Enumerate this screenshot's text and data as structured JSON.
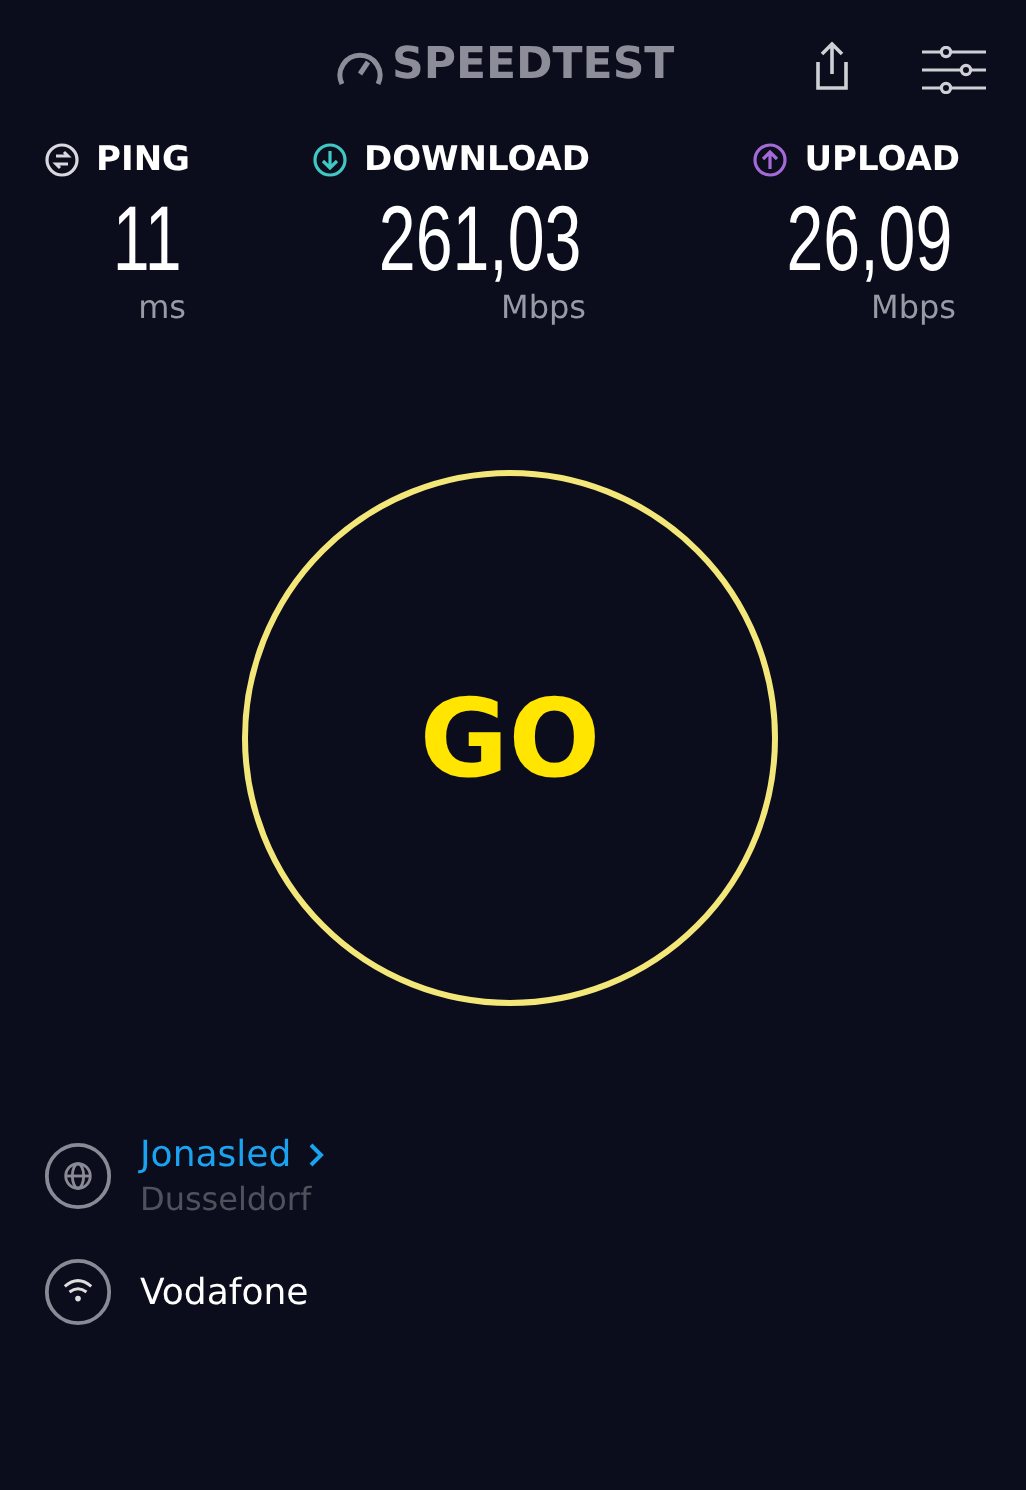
{
  "header": {
    "logo": "SPEEDTEST"
  },
  "metrics": [
    {
      "kind": "ping",
      "label": "PING",
      "value": "11",
      "unit": "ms",
      "color": "#d8d8de"
    },
    {
      "kind": "download",
      "label": "DOWNLOAD",
      "value": "261,03",
      "unit": "Mbps",
      "color": "#3ec9c4"
    },
    {
      "kind": "upload",
      "label": "UPLOAD",
      "value": "26,09",
      "unit": "Mbps",
      "color": "#a46bd8"
    }
  ],
  "go_button": {
    "label": "GO"
  },
  "server": {
    "name": "Jonasled",
    "location": "Dusseldorf"
  },
  "provider": {
    "name": "Vodafone"
  }
}
